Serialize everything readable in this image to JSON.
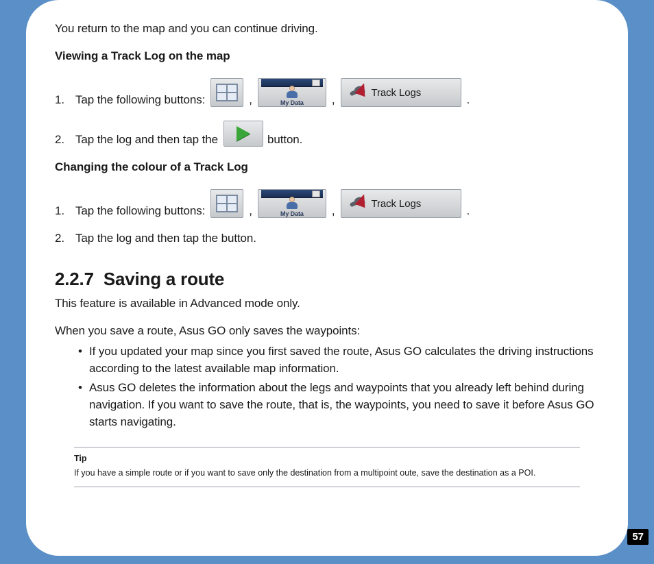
{
  "intro": "You return to the map and you can continue driving.",
  "sectionA": {
    "heading": "Viewing a Track Log on the map",
    "step1_num": "1.",
    "step1_text": "Tap the following buttons:",
    "step2_num": "2.",
    "step2_prefix": "Tap the log and then tap the",
    "step2_suffix": "button."
  },
  "sectionB": {
    "heading": "Changing the colour of a Track Log",
    "step1_num": "1.",
    "step1_text": "Tap the following buttons:",
    "step2_num": "2.",
    "step2_text": "Tap the log and then tap the button."
  },
  "buttons": {
    "mydata_label": "My Data",
    "tracklogs_label": "Track Logs"
  },
  "section227": {
    "number": "2.2.7",
    "title": "Saving a route",
    "p1": "This feature is available in Advanced mode only.",
    "p2": "When you save a route, Asus GO only saves the waypoints:",
    "bullets": [
      "If you updated your map since you first saved the route, Asus GO calculates the driving instructions according to the latest available map information.",
      "Asus GO deletes the information about the legs and waypoints that you already left behind during navigation. If you want to save the route, that is, the waypoints, you need to save it before Asus GO starts navigating."
    ]
  },
  "tip": {
    "label": "Tip",
    "text": "If you have a simple route or if you want to save only the destination from a multipoint oute, save the destination as a POI."
  },
  "punct": {
    "comma": ",",
    "period": "."
  },
  "page_number": "57"
}
